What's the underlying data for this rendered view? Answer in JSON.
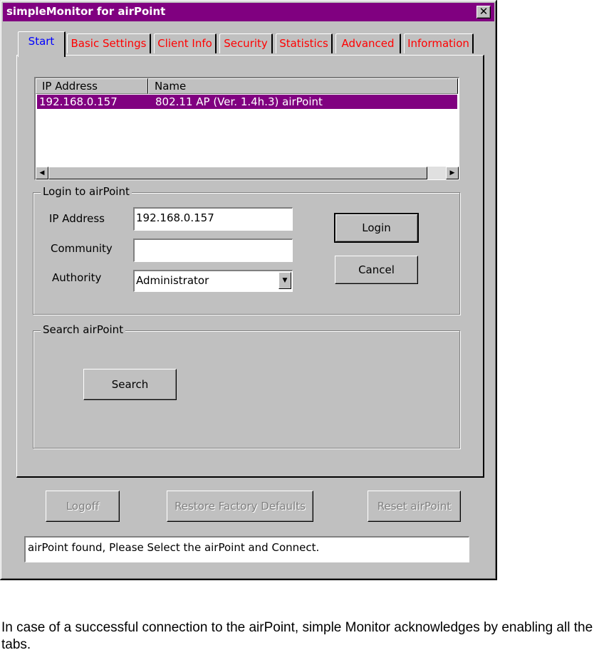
{
  "window": {
    "title": "simpleMonitor for airPoint",
    "close_glyph": "✕"
  },
  "tabs": [
    {
      "label": "Start",
      "active": true
    },
    {
      "label": "Basic Settings",
      "active": false
    },
    {
      "label": "Client Info",
      "active": false
    },
    {
      "label": "Security",
      "active": false
    },
    {
      "label": "Statistics",
      "active": false
    },
    {
      "label": "Advanced",
      "active": false
    },
    {
      "label": "Information",
      "active": false
    }
  ],
  "device_list": {
    "columns": [
      "IP Address",
      "Name"
    ],
    "rows": [
      {
        "ip": "192.168.0.157",
        "name": "802.11 AP (Ver. 1.4h.3) airPoint",
        "selected": true
      }
    ]
  },
  "login": {
    "group_title": "Login to airPoint",
    "ip_label": "IP Address",
    "ip_value": "192.168.0.157",
    "community_label": "Community",
    "community_value": "",
    "authority_label": "Authority",
    "authority_value": "Administrator",
    "login_button": "Login",
    "cancel_button": "Cancel"
  },
  "search": {
    "group_title": "Search airPoint",
    "search_button": "Search"
  },
  "footer_buttons": {
    "logoff": "Logoff",
    "restore": "Restore Factory Defaults",
    "reset": "Reset airPoint"
  },
  "status_text": "airPoint found, Please Select the airPoint and Connect.",
  "caption": "In case of a successful connection to the airPoint, simple Monitor acknowledges by enabling all the tabs.",
  "colors": {
    "titlebar": "#800080",
    "selection": "#800080",
    "tab_active_text": "#0000ff",
    "tab_inactive_text": "#ff0000",
    "face": "#c0c0c0"
  }
}
